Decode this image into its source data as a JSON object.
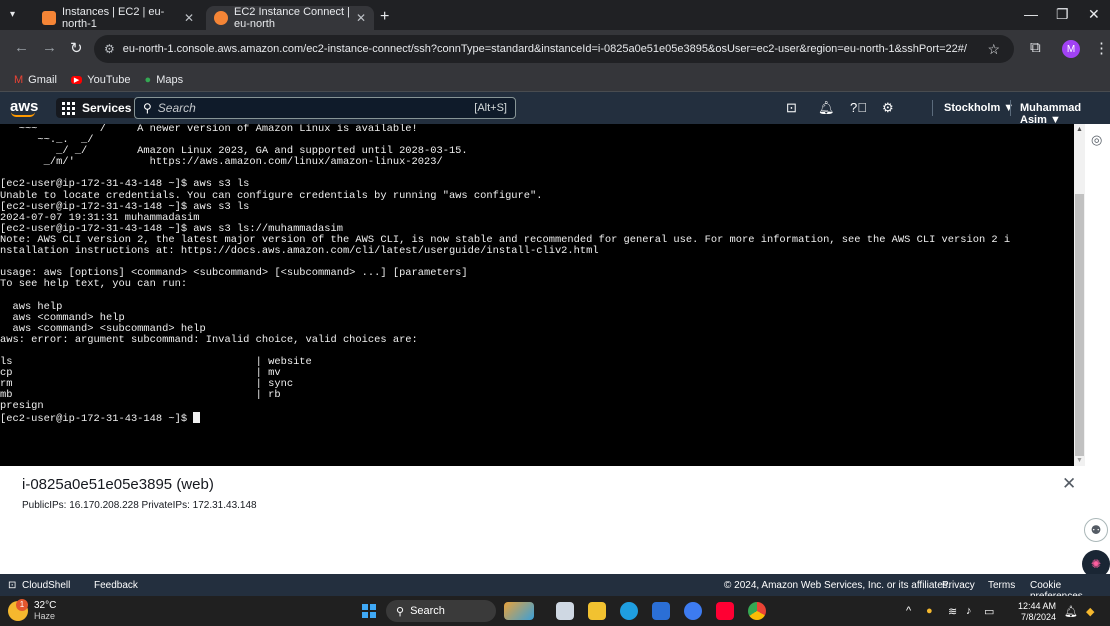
{
  "browser": {
    "tabs": [
      {
        "title": "Instances | EC2 | eu-north-1",
        "active": false,
        "favicon_color": "#f58536"
      },
      {
        "title": "EC2 Instance Connect | eu-north",
        "active": true,
        "favicon_color": "#f58536"
      }
    ],
    "url": "eu-north-1.console.aws.amazon.com/ec2-instance-connect/ssh?connType=standard&instanceId=i-0825a0e51e05e3895&osUser=ec2-user&region=eu-north-1&sshPort=22#/",
    "profile_initial": "M",
    "bookmarks": [
      {
        "label": "Gmail",
        "icon": "gmail-icon"
      },
      {
        "label": "YouTube",
        "icon": "youtube-icon"
      },
      {
        "label": "Maps",
        "icon": "maps-icon"
      }
    ]
  },
  "aws_nav": {
    "logo": "aws",
    "services_label": "Services",
    "search_placeholder": "Search",
    "search_shortcut": "[Alt+S]",
    "region": "Stockholm ▼",
    "user": "Muhammad Asim ▼"
  },
  "terminal": {
    "text": "   ~~~          /     A newer version of Amazon Linux is available!\n      ~~._.  _/\n         _/ _/        Amazon Linux 2023, GA and supported until 2028-03-15.\n       _/m/'            https://aws.amazon.com/linux/amazon-linux-2023/\n\n[ec2-user@ip-172-31-43-148 ~]$ aws s3 ls\nUnable to locate credentials. You can configure credentials by running \"aws configure\".\n[ec2-user@ip-172-31-43-148 ~]$ aws s3 ls\n2024-07-07 19:31:31 muhammadasim\n[ec2-user@ip-172-31-43-148 ~]$ aws s3 ls://muhammadasim\nNote: AWS CLI version 2, the latest major version of the AWS CLI, is now stable and recommended for general use. For more information, see the AWS CLI version 2 i\nnstallation instructions at: https://docs.aws.amazon.com/cli/latest/userguide/install-cliv2.html\n\nusage: aws [options] <command> <subcommand> [<subcommand> ...] [parameters]\nTo see help text, you can run:\n\n  aws help\n  aws <command> help\n  aws <command> <subcommand> help\naws: error: argument subcommand: Invalid choice, valid choices are:\n\nls                                       | website\ncp                                       | mv\nrm                                       | sync\nmb                                       | rb\npresign\n",
    "prompt": "[ec2-user@ip-172-31-43-148 ~]$ "
  },
  "instance": {
    "title": "i-0825a0e51e05e3895 (web)",
    "ips": "PublicIPs: 16.170.208.228   PrivateIPs: 172.31.43.148"
  },
  "footer": {
    "cloudshell": "CloudShell",
    "feedback": "Feedback",
    "copyright": "© 2024, Amazon Web Services, Inc. or its affiliates.",
    "privacy": "Privacy",
    "terms": "Terms",
    "cookies": "Cookie preferences"
  },
  "taskbar": {
    "temperature": "32°C",
    "condition": "Haze",
    "weather_badge": "1",
    "search_label": "Search",
    "time": "12:44 AM",
    "date": "7/8/2024"
  },
  "colors": {
    "aws_nav": "#232f3e",
    "aws_orange": "#ff9900",
    "terminal_bg": "#000000",
    "chrome_dark": "#202124"
  }
}
